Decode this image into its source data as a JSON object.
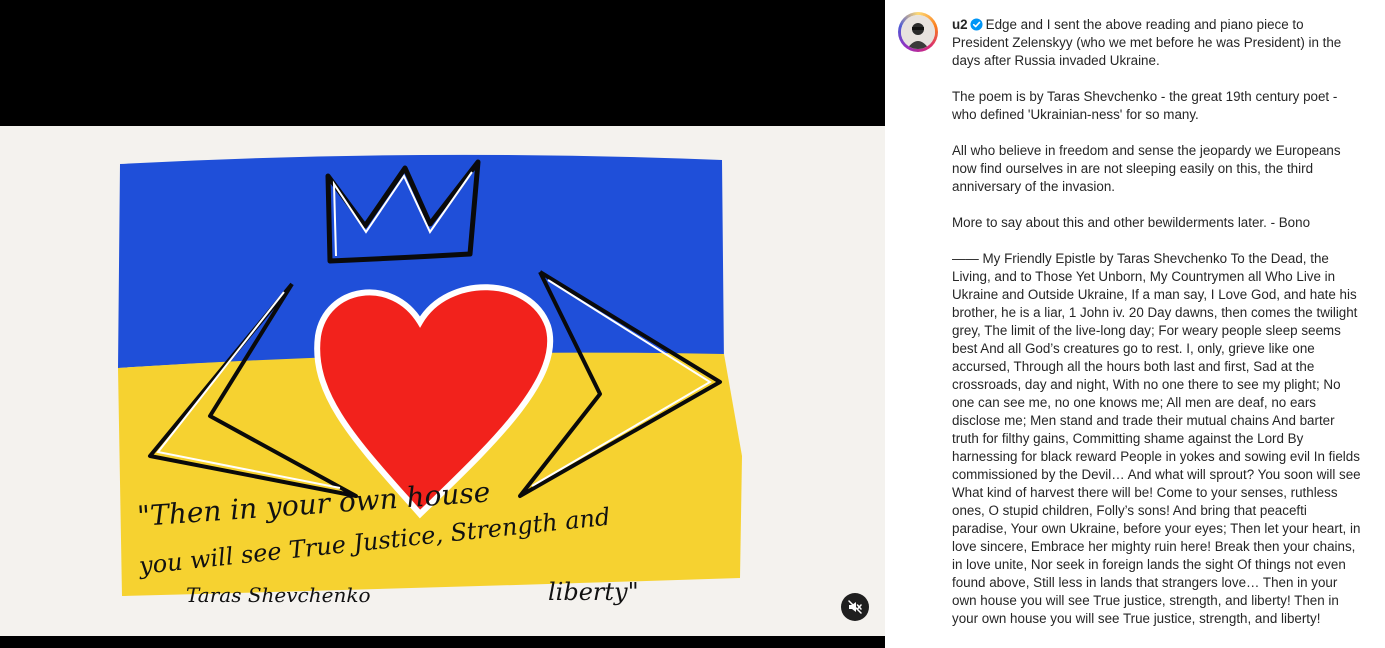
{
  "media": {
    "artwork": {
      "quote_lines": [
        "\"Then in your own house",
        "you will see  True Justice, Strength and",
        "liberty\""
      ],
      "signature": "Taras Shevchenko",
      "colors": {
        "blue": "#1f4fd9",
        "yellow": "#f6d230",
        "heart": "#f2221c",
        "canvas": "#f4f2ee"
      }
    },
    "mute_icon": "volume-muted-icon"
  },
  "post": {
    "username": "u2",
    "verified_icon": "verified-badge-icon",
    "caption_first": "Edge and I sent the above reading and piano piece to President Zelenskyy (who we met before he was President) in the days after Russia invaded Ukraine.",
    "paragraphs": [
      "The poem is by Taras Shevchenko - the great 19th century poet - who defined 'Ukrainian-ness' for so many.",
      "All who believe in freedom and sense the jeopardy we Europeans now find ourselves in are not sleeping easily on this, the third anniversary of the invasion.",
      "More to say about this and other bewilderments later. - Bono",
      "—— My Friendly Epistle by Taras Shevchenko  To the Dead, the Living, and to Those Yet Unborn, My Countrymen all Who Live in Ukraine and Outside Ukraine,  If a man say, I Love God, and hate his brother, he is a liar, 1 John iv. 20  Day dawns, then comes the twilight grey, The limit of the live-long day; For weary people sleep seems best And all God’s creatures go to rest. I, only, grieve like one accursed, Through all the hours both last and first, Sad at the crossroads, day and night, With no one there to see my plight; No one can see me, no one knows me; All men are deaf, no ears disclose me; Men stand and trade their mutual chains And barter truth for filthy gains, Committing shame against the Lord By harnessing for black reward People in yokes and sowing evil In fields commissioned by the Devil… And what will sprout? You soon will see What kind of harvest there will be! Come to your senses, ruthless ones, O stupid children, Folly’s sons! And bring that peacefti paradise, Your own Ukraine, before your eyes; Then let your heart, in love sincere, Embrace her mighty ruin here! Break then your chains, in love unite, Nor seek in foreign lands the sight Of things not even found above, Still less in lands that strangers love… Then in your own house you will see True justice, strength, and liberty! Then in your own house you will see True justice, strength, and liberty!"
    ]
  }
}
